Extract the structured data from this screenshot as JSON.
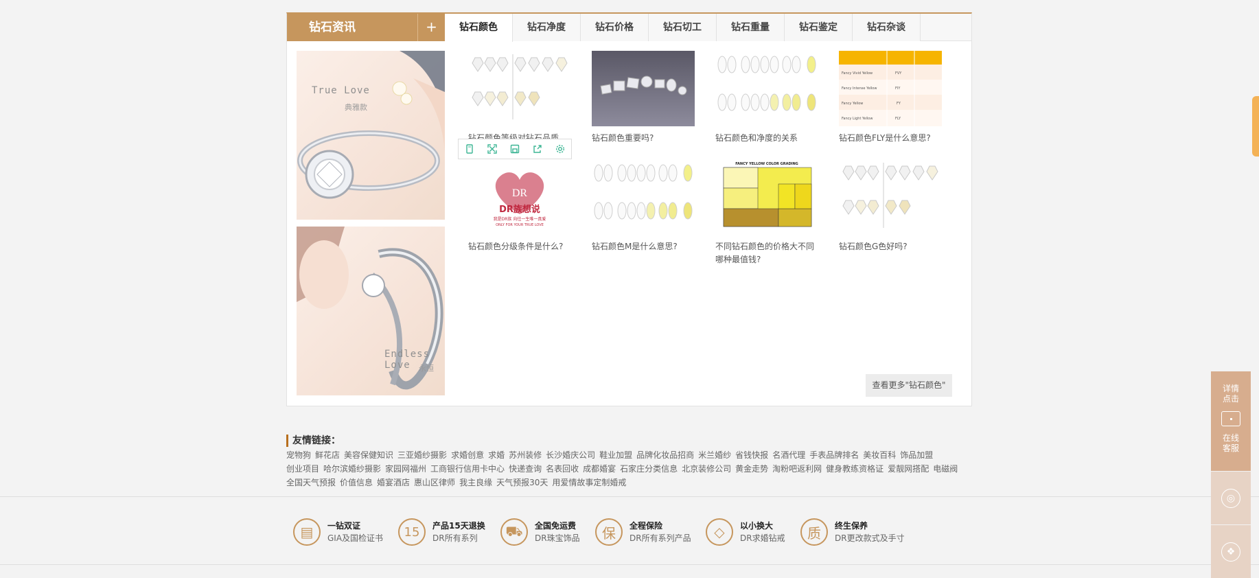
{
  "panel": {
    "section_title": "钻石资讯",
    "plus_label": "+",
    "tabs": [
      {
        "label": "钻石颜色",
        "active": true
      },
      {
        "label": "钻石净度"
      },
      {
        "label": "钻石价格"
      },
      {
        "label": "钻石切工"
      },
      {
        "label": "钻石重量"
      },
      {
        "label": "钻石鉴定"
      },
      {
        "label": "钻石杂谈"
      }
    ],
    "banners": [
      {
        "text": "True Love",
        "sub": "典雅款"
      },
      {
        "text": "Endless Love",
        "sub": "永恒"
      }
    ],
    "news": [
      {
        "caption": "钻石颜色等级对钻石品质"
      },
      {
        "caption": "钻石颜色重要吗?"
      },
      {
        "caption": "钻石颜色和净度的关系"
      },
      {
        "caption": "钻石颜色FLY是什么意思?"
      },
      {
        "caption": "钻石颜色分级条件是什么?"
      },
      {
        "caption": "钻石颜色M是什么意思?"
      },
      {
        "caption": "不同钻石颜色的价格大不同 哪种最值钱?"
      },
      {
        "caption": "钻石颜色G色好吗?"
      }
    ],
    "thumb_labels": {
      "dr_brand": "DR族想说",
      "dr_line": "我是DR族 向往一生唯一真爱",
      "dr_en": "ONLY FOR YOUR TRUE LOVE",
      "fancy_title": "FANCY YELLOW COLOR GRADING",
      "fancy_rows": [
        "Fancy Vivid Yellow",
        "Fancy Intense Yellow",
        "Fancy Yellow",
        "Fancy Light Yellow"
      ],
      "fly_codes": [
        "FVY",
        "FIY",
        "FY",
        "FLY"
      ]
    },
    "more_button": "查看更多\"钻石颜色\""
  },
  "links": {
    "title": "友情链接：",
    "rows": [
      [
        "宠物狗",
        "鲜花店",
        "美容保健知识",
        "三亚婚纱摄影",
        "求婚创意",
        "求婚",
        "苏州装修",
        "长沙婚庆公司",
        "鞋业加盟",
        "品牌化妆品招商",
        "米兰婚纱",
        "省钱快报",
        "名酒代理",
        "手表品牌排名",
        "美妆百科",
        "饰品加盟"
      ],
      [
        "创业项目",
        "哈尔滨婚纱摄影",
        "家园网福州",
        "工商银行信用卡中心",
        "快递查询",
        "名表回收",
        "成都婚宴",
        "石家庄分类信息",
        "北京装修公司",
        "黄金走势",
        "淘粉吧返利网",
        "健身教练资格证",
        "爱靓网搭配",
        "电磁阀"
      ],
      [
        "全国天气预报",
        "价值信息",
        "婚宴酒店",
        "惠山区律师",
        "我主良缘",
        "天气预报30天",
        "用爱情故事定制婚戒"
      ]
    ]
  },
  "services": [
    {
      "icon": "▤",
      "title": "一钻双证",
      "sub": "GIA及国检证书"
    },
    {
      "icon": "15",
      "title": "产品15天退换",
      "sub": "DR所有系列"
    },
    {
      "icon": "⛟",
      "title": "全国免运费",
      "sub": "DR珠宝饰品"
    },
    {
      "icon": "保",
      "title": "全程保险",
      "sub": "DR所有系列产品"
    },
    {
      "icon": "◇",
      "title": "以小换大",
      "sub": "DR求婚钻戒"
    },
    {
      "icon": "质",
      "title": "终生保养",
      "sub": "DR更改款式及手寸"
    }
  ],
  "side": {
    "detail": "详情",
    "click": "点击",
    "online": "在线",
    "service": "客服"
  },
  "colors": {
    "accent": "#c6965d",
    "side": "#d7ad8e",
    "right_tab": "#f4b256"
  }
}
